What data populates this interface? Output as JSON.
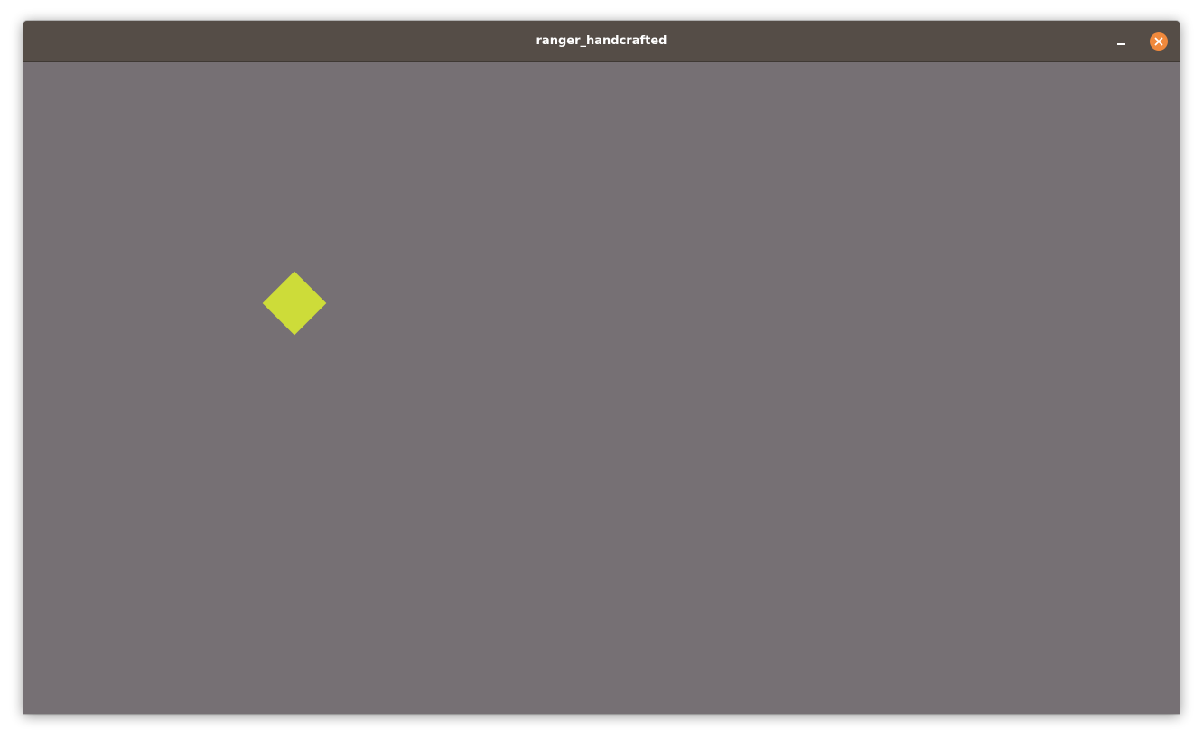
{
  "window": {
    "title": "ranger_handcrafted"
  },
  "titlebar": {
    "minimize_icon": "minimize-icon",
    "close_icon": "close-icon"
  },
  "colors": {
    "titlebar": "#554d47",
    "canvas": "#767074",
    "close_button": "#f0893c",
    "diamond": "#cddc39"
  }
}
